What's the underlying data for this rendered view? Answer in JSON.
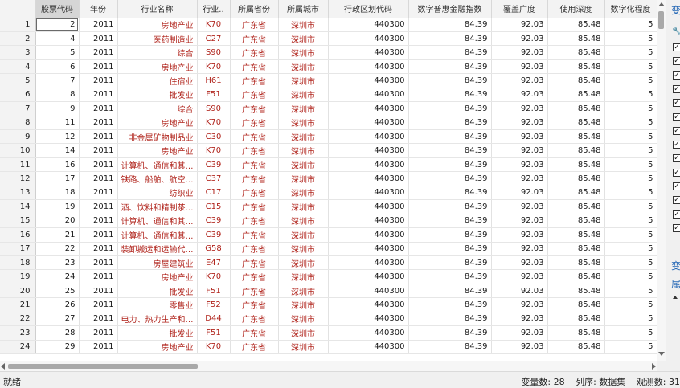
{
  "columns": [
    "",
    "股票代码",
    "年份",
    "行业名称",
    "行业..",
    "所属省份",
    "所属城市",
    "行政区划代码",
    "数字普惠金融指数",
    "覆盖广度",
    "使用深度",
    "数字化程度"
  ],
  "rows": [
    {
      "n": "1",
      "code": "2",
      "year": "2011",
      "industry": "房地产业",
      "ic": "K70",
      "prov": "广东省",
      "city": "深圳市",
      "area": "440300",
      "idx": "84.39",
      "cov": "92.03",
      "dep": "85.48",
      "dig": "5"
    },
    {
      "n": "2",
      "code": "4",
      "year": "2011",
      "industry": "医药制造业",
      "ic": "C27",
      "prov": "广东省",
      "city": "深圳市",
      "area": "440300",
      "idx": "84.39",
      "cov": "92.03",
      "dep": "85.48",
      "dig": "5"
    },
    {
      "n": "3",
      "code": "5",
      "year": "2011",
      "industry": "综合",
      "ic": "S90",
      "prov": "广东省",
      "city": "深圳市",
      "area": "440300",
      "idx": "84.39",
      "cov": "92.03",
      "dep": "85.48",
      "dig": "5"
    },
    {
      "n": "4",
      "code": "6",
      "year": "2011",
      "industry": "房地产业",
      "ic": "K70",
      "prov": "广东省",
      "city": "深圳市",
      "area": "440300",
      "idx": "84.39",
      "cov": "92.03",
      "dep": "85.48",
      "dig": "5"
    },
    {
      "n": "5",
      "code": "7",
      "year": "2011",
      "industry": "住宿业",
      "ic": "H61",
      "prov": "广东省",
      "city": "深圳市",
      "area": "440300",
      "idx": "84.39",
      "cov": "92.03",
      "dep": "85.48",
      "dig": "5"
    },
    {
      "n": "6",
      "code": "8",
      "year": "2011",
      "industry": "批发业",
      "ic": "F51",
      "prov": "广东省",
      "city": "深圳市",
      "area": "440300",
      "idx": "84.39",
      "cov": "92.03",
      "dep": "85.48",
      "dig": "5"
    },
    {
      "n": "7",
      "code": "9",
      "year": "2011",
      "industry": "综合",
      "ic": "S90",
      "prov": "广东省",
      "city": "深圳市",
      "area": "440300",
      "idx": "84.39",
      "cov": "92.03",
      "dep": "85.48",
      "dig": "5"
    },
    {
      "n": "8",
      "code": "11",
      "year": "2011",
      "industry": "房地产业",
      "ic": "K70",
      "prov": "广东省",
      "city": "深圳市",
      "area": "440300",
      "idx": "84.39",
      "cov": "92.03",
      "dep": "85.48",
      "dig": "5"
    },
    {
      "n": "9",
      "code": "12",
      "year": "2011",
      "industry": "非金属矿物制品业",
      "ic": "C30",
      "prov": "广东省",
      "city": "深圳市",
      "area": "440300",
      "idx": "84.39",
      "cov": "92.03",
      "dep": "85.48",
      "dig": "5"
    },
    {
      "n": "10",
      "code": "14",
      "year": "2011",
      "industry": "房地产业",
      "ic": "K70",
      "prov": "广东省",
      "city": "深圳市",
      "area": "440300",
      "idx": "84.39",
      "cov": "92.03",
      "dep": "85.48",
      "dig": "5"
    },
    {
      "n": "11",
      "code": "16",
      "year": "2011",
      "industry": "计算机、通信和其…",
      "ic": "C39",
      "prov": "广东省",
      "city": "深圳市",
      "area": "440300",
      "idx": "84.39",
      "cov": "92.03",
      "dep": "85.48",
      "dig": "5"
    },
    {
      "n": "12",
      "code": "17",
      "year": "2011",
      "industry": "铁路、船舶、航空…",
      "ic": "C37",
      "prov": "广东省",
      "city": "深圳市",
      "area": "440300",
      "idx": "84.39",
      "cov": "92.03",
      "dep": "85.48",
      "dig": "5"
    },
    {
      "n": "13",
      "code": "18",
      "year": "2011",
      "industry": "纺织业",
      "ic": "C17",
      "prov": "广东省",
      "city": "深圳市",
      "area": "440300",
      "idx": "84.39",
      "cov": "92.03",
      "dep": "85.48",
      "dig": "5"
    },
    {
      "n": "14",
      "code": "19",
      "year": "2011",
      "industry": "酒、饮料和精制茶…",
      "ic": "C15",
      "prov": "广东省",
      "city": "深圳市",
      "area": "440300",
      "idx": "84.39",
      "cov": "92.03",
      "dep": "85.48",
      "dig": "5"
    },
    {
      "n": "15",
      "code": "20",
      "year": "2011",
      "industry": "计算机、通信和其…",
      "ic": "C39",
      "prov": "广东省",
      "city": "深圳市",
      "area": "440300",
      "idx": "84.39",
      "cov": "92.03",
      "dep": "85.48",
      "dig": "5"
    },
    {
      "n": "16",
      "code": "21",
      "year": "2011",
      "industry": "计算机、通信和其…",
      "ic": "C39",
      "prov": "广东省",
      "city": "深圳市",
      "area": "440300",
      "idx": "84.39",
      "cov": "92.03",
      "dep": "85.48",
      "dig": "5"
    },
    {
      "n": "17",
      "code": "22",
      "year": "2011",
      "industry": "装卸搬运和运输代…",
      "ic": "G58",
      "prov": "广东省",
      "city": "深圳市",
      "area": "440300",
      "idx": "84.39",
      "cov": "92.03",
      "dep": "85.48",
      "dig": "5"
    },
    {
      "n": "18",
      "code": "23",
      "year": "2011",
      "industry": "房屋建筑业",
      "ic": "E47",
      "prov": "广东省",
      "city": "深圳市",
      "area": "440300",
      "idx": "84.39",
      "cov": "92.03",
      "dep": "85.48",
      "dig": "5"
    },
    {
      "n": "19",
      "code": "24",
      "year": "2011",
      "industry": "房地产业",
      "ic": "K70",
      "prov": "广东省",
      "city": "深圳市",
      "area": "440300",
      "idx": "84.39",
      "cov": "92.03",
      "dep": "85.48",
      "dig": "5"
    },
    {
      "n": "20",
      "code": "25",
      "year": "2011",
      "industry": "批发业",
      "ic": "F51",
      "prov": "广东省",
      "city": "深圳市",
      "area": "440300",
      "idx": "84.39",
      "cov": "92.03",
      "dep": "85.48",
      "dig": "5"
    },
    {
      "n": "21",
      "code": "26",
      "year": "2011",
      "industry": "零售业",
      "ic": "F52",
      "prov": "广东省",
      "city": "深圳市",
      "area": "440300",
      "idx": "84.39",
      "cov": "92.03",
      "dep": "85.48",
      "dig": "5"
    },
    {
      "n": "22",
      "code": "27",
      "year": "2011",
      "industry": "电力、热力生产和…",
      "ic": "D44",
      "prov": "广东省",
      "city": "深圳市",
      "area": "440300",
      "idx": "84.39",
      "cov": "92.03",
      "dep": "85.48",
      "dig": "5"
    },
    {
      "n": "23",
      "code": "28",
      "year": "2011",
      "industry": "批发业",
      "ic": "F51",
      "prov": "广东省",
      "city": "深圳市",
      "area": "440300",
      "idx": "84.39",
      "cov": "92.03",
      "dep": "85.48",
      "dig": "5"
    },
    {
      "n": "24",
      "code": "29",
      "year": "2011",
      "industry": "房地产业",
      "ic": "K70",
      "prov": "广东省",
      "city": "深圳市",
      "area": "440300",
      "idx": "84.39",
      "cov": "92.03",
      "dep": "85.48",
      "dig": "5"
    }
  ],
  "side_panel": {
    "tab_top": "变",
    "tab_mid": "变",
    "tab_bottom": "属",
    "wrench_icon": "wrench-icon",
    "checkbox_count": 14
  },
  "status": {
    "left": "就绪",
    "var_count": "变量数: 28",
    "order": "列序: 数据集",
    "obs": "观测数: 31"
  }
}
